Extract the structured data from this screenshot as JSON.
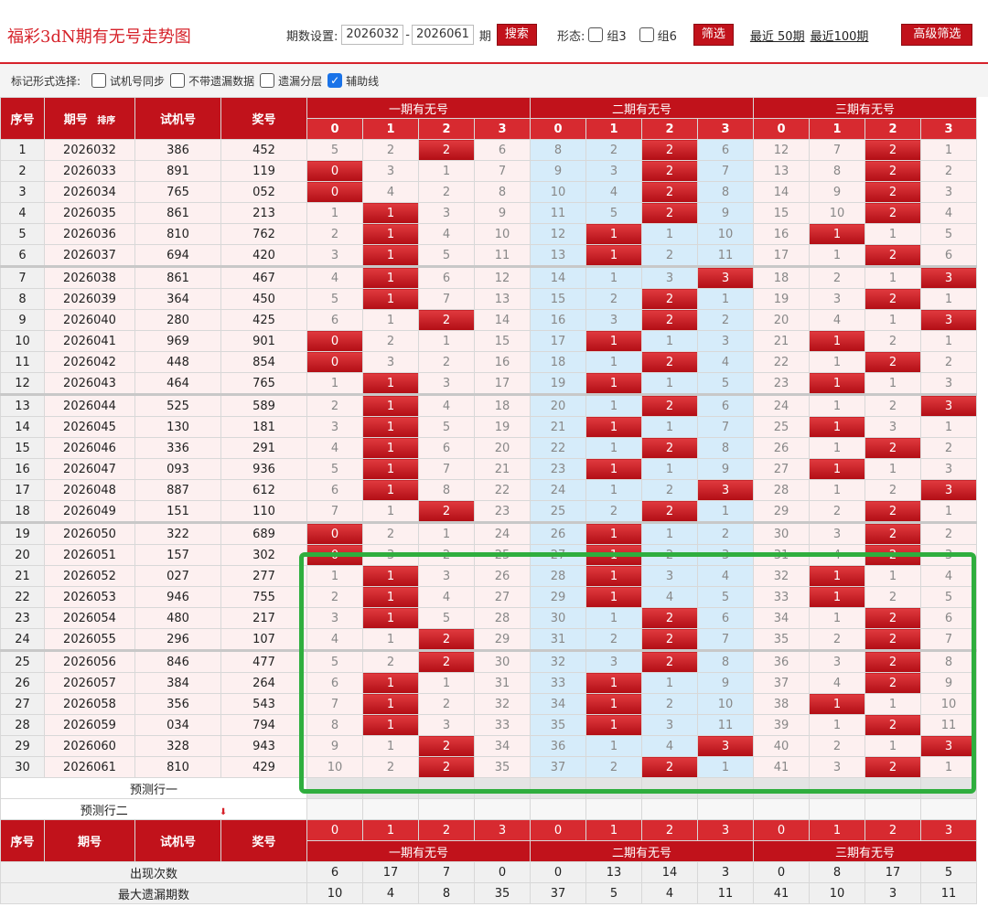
{
  "title": "福彩3dN期有无号走势图",
  "settings": {
    "period_label": "期数设置:",
    "from": "2026032",
    "to": "2026061",
    "period_suffix": "期",
    "search_btn": "搜索",
    "shape_label": "形态:",
    "group3": "组3",
    "group6": "组6",
    "filter_btn": "筛选",
    "recent50": "最近 50期",
    "recent100": "最近100期",
    "advanced_btn": "高级筛选"
  },
  "mark": {
    "label": "标记形式选择:",
    "opt1": "试机号同步",
    "opt2": "不带遗漏数据",
    "opt3": "遗漏分层",
    "opt4": "辅助线"
  },
  "headers": {
    "seq": "序号",
    "period": "期号",
    "sort": "排序",
    "trial": "试机号",
    "prize": "奖号",
    "g1": "一期有无号",
    "g2": "二期有无号",
    "g3": "三期有无号",
    "digits": [
      "0",
      "1",
      "2",
      "3",
      "0",
      "1",
      "2",
      "3",
      "0",
      "1",
      "2",
      "3"
    ]
  },
  "rows": [
    {
      "seq": "1",
      "period": "2026032",
      "trial": "386",
      "prize": "452",
      "cells": [
        "5",
        "2",
        "2",
        "6",
        "8",
        "2",
        "2",
        "6",
        "12",
        "7",
        "2",
        "1"
      ],
      "hits": [
        0,
        0,
        1,
        0,
        0,
        0,
        1,
        0,
        0,
        0,
        1,
        0
      ]
    },
    {
      "seq": "2",
      "period": "2026033",
      "trial": "891",
      "prize": "119",
      "cells": [
        "0",
        "3",
        "1",
        "7",
        "9",
        "3",
        "2",
        "7",
        "13",
        "8",
        "2",
        "2"
      ],
      "hits": [
        1,
        0,
        0,
        0,
        0,
        0,
        1,
        0,
        0,
        0,
        1,
        0
      ]
    },
    {
      "seq": "3",
      "period": "2026034",
      "trial": "765",
      "prize": "052",
      "cells": [
        "0",
        "4",
        "2",
        "8",
        "10",
        "4",
        "2",
        "8",
        "14",
        "9",
        "2",
        "3"
      ],
      "hits": [
        1,
        0,
        0,
        0,
        0,
        0,
        1,
        0,
        0,
        0,
        1,
        0
      ]
    },
    {
      "seq": "4",
      "period": "2026035",
      "trial": "861",
      "prize": "213",
      "cells": [
        "1",
        "1",
        "3",
        "9",
        "11",
        "5",
        "2",
        "9",
        "15",
        "10",
        "2",
        "4"
      ],
      "hits": [
        0,
        1,
        0,
        0,
        0,
        0,
        1,
        0,
        0,
        0,
        1,
        0
      ]
    },
    {
      "seq": "5",
      "period": "2026036",
      "trial": "810",
      "prize": "762",
      "cells": [
        "2",
        "1",
        "4",
        "10",
        "12",
        "1",
        "1",
        "10",
        "16",
        "1",
        "1",
        "5"
      ],
      "hits": [
        0,
        1,
        0,
        0,
        0,
        1,
        0,
        0,
        0,
        1,
        0,
        0
      ]
    },
    {
      "seq": "6",
      "period": "2026037",
      "trial": "694",
      "prize": "420",
      "cells": [
        "3",
        "1",
        "5",
        "11",
        "13",
        "1",
        "2",
        "11",
        "17",
        "1",
        "2",
        "6"
      ],
      "hits": [
        0,
        1,
        0,
        0,
        0,
        1,
        0,
        0,
        0,
        0,
        1,
        0
      ]
    },
    {
      "seq": "7",
      "period": "2026038",
      "trial": "861",
      "prize": "467",
      "cells": [
        "4",
        "1",
        "6",
        "12",
        "14",
        "1",
        "3",
        "3",
        "18",
        "2",
        "1",
        "3"
      ],
      "hits": [
        0,
        1,
        0,
        0,
        0,
        0,
        0,
        1,
        0,
        0,
        0,
        1
      ]
    },
    {
      "seq": "8",
      "period": "2026039",
      "trial": "364",
      "prize": "450",
      "cells": [
        "5",
        "1",
        "7",
        "13",
        "15",
        "2",
        "2",
        "1",
        "19",
        "3",
        "2",
        "1"
      ],
      "hits": [
        0,
        1,
        0,
        0,
        0,
        0,
        1,
        0,
        0,
        0,
        1,
        0
      ]
    },
    {
      "seq": "9",
      "period": "2026040",
      "trial": "280",
      "prize": "425",
      "cells": [
        "6",
        "1",
        "2",
        "14",
        "16",
        "3",
        "2",
        "2",
        "20",
        "4",
        "1",
        "3"
      ],
      "hits": [
        0,
        0,
        1,
        0,
        0,
        0,
        1,
        0,
        0,
        0,
        0,
        1
      ]
    },
    {
      "seq": "10",
      "period": "2026041",
      "trial": "969",
      "prize": "901",
      "cells": [
        "0",
        "2",
        "1",
        "15",
        "17",
        "1",
        "1",
        "3",
        "21",
        "1",
        "2",
        "1"
      ],
      "hits": [
        1,
        0,
        0,
        0,
        0,
        1,
        0,
        0,
        0,
        1,
        0,
        0
      ]
    },
    {
      "seq": "11",
      "period": "2026042",
      "trial": "448",
      "prize": "854",
      "cells": [
        "0",
        "3",
        "2",
        "16",
        "18",
        "1",
        "2",
        "4",
        "22",
        "1",
        "2",
        "2"
      ],
      "hits": [
        1,
        0,
        0,
        0,
        0,
        0,
        1,
        0,
        0,
        0,
        1,
        0
      ]
    },
    {
      "seq": "12",
      "period": "2026043",
      "trial": "464",
      "prize": "765",
      "cells": [
        "1",
        "1",
        "3",
        "17",
        "19",
        "1",
        "1",
        "5",
        "23",
        "1",
        "1",
        "3"
      ],
      "hits": [
        0,
        1,
        0,
        0,
        0,
        1,
        0,
        0,
        0,
        1,
        0,
        0
      ]
    },
    {
      "seq": "13",
      "period": "2026044",
      "trial": "525",
      "prize": "589",
      "cells": [
        "2",
        "1",
        "4",
        "18",
        "20",
        "1",
        "2",
        "6",
        "24",
        "1",
        "2",
        "3"
      ],
      "hits": [
        0,
        1,
        0,
        0,
        0,
        0,
        1,
        0,
        0,
        0,
        0,
        1
      ]
    },
    {
      "seq": "14",
      "period": "2026045",
      "trial": "130",
      "prize": "181",
      "cells": [
        "3",
        "1",
        "5",
        "19",
        "21",
        "1",
        "1",
        "7",
        "25",
        "1",
        "3",
        "1"
      ],
      "hits": [
        0,
        1,
        0,
        0,
        0,
        1,
        0,
        0,
        0,
        1,
        0,
        0
      ]
    },
    {
      "seq": "15",
      "period": "2026046",
      "trial": "336",
      "prize": "291",
      "cells": [
        "4",
        "1",
        "6",
        "20",
        "22",
        "1",
        "2",
        "8",
        "26",
        "1",
        "2",
        "2"
      ],
      "hits": [
        0,
        1,
        0,
        0,
        0,
        0,
        1,
        0,
        0,
        0,
        1,
        0
      ]
    },
    {
      "seq": "16",
      "period": "2026047",
      "trial": "093",
      "prize": "936",
      "cells": [
        "5",
        "1",
        "7",
        "21",
        "23",
        "1",
        "1",
        "9",
        "27",
        "1",
        "1",
        "3"
      ],
      "hits": [
        0,
        1,
        0,
        0,
        0,
        1,
        0,
        0,
        0,
        1,
        0,
        0
      ]
    },
    {
      "seq": "17",
      "period": "2026048",
      "trial": "887",
      "prize": "612",
      "cells": [
        "6",
        "1",
        "8",
        "22",
        "24",
        "1",
        "2",
        "3",
        "28",
        "1",
        "2",
        "3"
      ],
      "hits": [
        0,
        1,
        0,
        0,
        0,
        0,
        0,
        1,
        0,
        0,
        0,
        1
      ]
    },
    {
      "seq": "18",
      "period": "2026049",
      "trial": "151",
      "prize": "110",
      "cells": [
        "7",
        "1",
        "2",
        "23",
        "25",
        "2",
        "2",
        "1",
        "29",
        "2",
        "2",
        "1"
      ],
      "hits": [
        0,
        0,
        1,
        0,
        0,
        0,
        1,
        0,
        0,
        0,
        1,
        0
      ]
    },
    {
      "seq": "19",
      "period": "2026050",
      "trial": "322",
      "prize": "689",
      "cells": [
        "0",
        "2",
        "1",
        "24",
        "26",
        "1",
        "1",
        "2",
        "30",
        "3",
        "2",
        "2"
      ],
      "hits": [
        1,
        0,
        0,
        0,
        0,
        1,
        0,
        0,
        0,
        0,
        1,
        0
      ]
    },
    {
      "seq": "20",
      "period": "2026051",
      "trial": "157",
      "prize": "302",
      "cells": [
        "0",
        "3",
        "2",
        "25",
        "27",
        "1",
        "2",
        "3",
        "31",
        "4",
        "2",
        "3"
      ],
      "hits": [
        1,
        0,
        0,
        0,
        0,
        1,
        0,
        0,
        0,
        0,
        1,
        0
      ]
    },
    {
      "seq": "21",
      "period": "2026052",
      "trial": "027",
      "prize": "277",
      "cells": [
        "1",
        "1",
        "3",
        "26",
        "28",
        "1",
        "3",
        "4",
        "32",
        "1",
        "1",
        "4"
      ],
      "hits": [
        0,
        1,
        0,
        0,
        0,
        1,
        0,
        0,
        0,
        1,
        0,
        0
      ]
    },
    {
      "seq": "22",
      "period": "2026053",
      "trial": "946",
      "prize": "755",
      "cells": [
        "2",
        "1",
        "4",
        "27",
        "29",
        "1",
        "4",
        "5",
        "33",
        "1",
        "2",
        "5"
      ],
      "hits": [
        0,
        1,
        0,
        0,
        0,
        1,
        0,
        0,
        0,
        1,
        0,
        0
      ]
    },
    {
      "seq": "23",
      "period": "2026054",
      "trial": "480",
      "prize": "217",
      "cells": [
        "3",
        "1",
        "5",
        "28",
        "30",
        "1",
        "2",
        "6",
        "34",
        "1",
        "2",
        "6"
      ],
      "hits": [
        0,
        1,
        0,
        0,
        0,
        0,
        1,
        0,
        0,
        0,
        1,
        0
      ]
    },
    {
      "seq": "24",
      "period": "2026055",
      "trial": "296",
      "prize": "107",
      "cells": [
        "4",
        "1",
        "2",
        "29",
        "31",
        "2",
        "2",
        "7",
        "35",
        "2",
        "2",
        "7"
      ],
      "hits": [
        0,
        0,
        1,
        0,
        0,
        0,
        1,
        0,
        0,
        0,
        1,
        0
      ]
    },
    {
      "seq": "25",
      "period": "2026056",
      "trial": "846",
      "prize": "477",
      "cells": [
        "5",
        "2",
        "2",
        "30",
        "32",
        "3",
        "2",
        "8",
        "36",
        "3",
        "2",
        "8"
      ],
      "hits": [
        0,
        0,
        1,
        0,
        0,
        0,
        1,
        0,
        0,
        0,
        1,
        0
      ]
    },
    {
      "seq": "26",
      "period": "2026057",
      "trial": "384",
      "prize": "264",
      "cells": [
        "6",
        "1",
        "1",
        "31",
        "33",
        "1",
        "1",
        "9",
        "37",
        "4",
        "2",
        "9"
      ],
      "hits": [
        0,
        1,
        0,
        0,
        0,
        1,
        0,
        0,
        0,
        0,
        1,
        0
      ]
    },
    {
      "seq": "27",
      "period": "2026058",
      "trial": "356",
      "prize": "543",
      "cells": [
        "7",
        "1",
        "2",
        "32",
        "34",
        "1",
        "2",
        "10",
        "38",
        "1",
        "1",
        "10"
      ],
      "hits": [
        0,
        1,
        0,
        0,
        0,
        1,
        0,
        0,
        0,
        1,
        0,
        0
      ]
    },
    {
      "seq": "28",
      "period": "2026059",
      "trial": "034",
      "prize": "794",
      "cells": [
        "8",
        "1",
        "3",
        "33",
        "35",
        "1",
        "3",
        "11",
        "39",
        "1",
        "2",
        "11"
      ],
      "hits": [
        0,
        1,
        0,
        0,
        0,
        1,
        0,
        0,
        0,
        0,
        1,
        0
      ]
    },
    {
      "seq": "29",
      "period": "2026060",
      "trial": "328",
      "prize": "943",
      "cells": [
        "9",
        "1",
        "2",
        "34",
        "36",
        "1",
        "4",
        "3",
        "40",
        "2",
        "1",
        "3"
      ],
      "hits": [
        0,
        0,
        1,
        0,
        0,
        0,
        0,
        1,
        0,
        0,
        0,
        1
      ]
    },
    {
      "seq": "30",
      "period": "2026061",
      "trial": "810",
      "prize": "429",
      "cells": [
        "10",
        "2",
        "2",
        "35",
        "37",
        "2",
        "2",
        "1",
        "41",
        "3",
        "2",
        "1"
      ],
      "hits": [
        0,
        0,
        1,
        0,
        0,
        0,
        1,
        0,
        0,
        0,
        1,
        0
      ]
    }
  ],
  "predict": {
    "row1": "预测行一",
    "row2": "预测行二"
  },
  "summary": [
    {
      "label": "出现次数",
      "values": [
        "6",
        "17",
        "7",
        "0",
        "0",
        "13",
        "14",
        "3",
        "0",
        "8",
        "17",
        "5"
      ]
    },
    {
      "label": "最大遗漏期数",
      "values": [
        "10",
        "4",
        "8",
        "35",
        "37",
        "5",
        "4",
        "11",
        "41",
        "10",
        "3",
        "11"
      ]
    }
  ],
  "colors": {
    "brand": "#c1121b",
    "highlight_box": "#2fae3e"
  }
}
